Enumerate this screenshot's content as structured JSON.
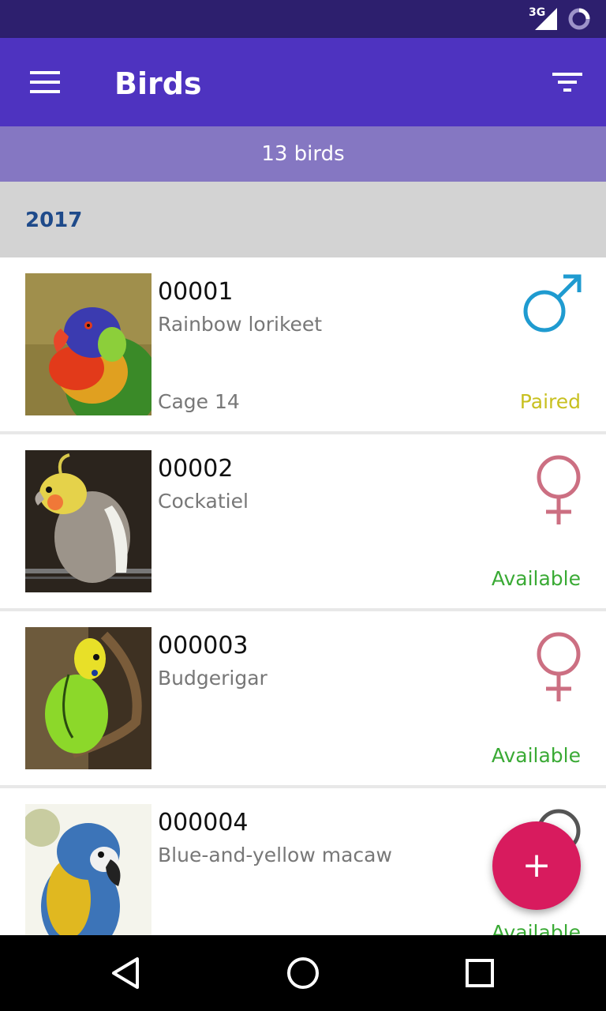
{
  "status_bar": {
    "network": "3G",
    "signal_icon": "signal-icon",
    "battery_icon": "battery-icon"
  },
  "app_bar": {
    "title": "Birds",
    "menu_icon": "menu-icon",
    "filter_icon": "filter-icon",
    "background": "#4e33c0"
  },
  "summary": {
    "count_label": "13 birds"
  },
  "section": {
    "year": "2017"
  },
  "birds": [
    {
      "id": "00001",
      "species": "Rainbow lorikeet",
      "cage": "Cage 14",
      "status": "Paired",
      "status_color": "#c8c020",
      "gender": "male",
      "gender_color": "#1f9bd0"
    },
    {
      "id": "00002",
      "species": "Cockatiel",
      "cage": "",
      "status": "Available",
      "status_color": "#3aaa35",
      "gender": "female",
      "gender_color": "#cc6f82"
    },
    {
      "id": "000003",
      "species": "Budgerigar",
      "cage": "",
      "status": "Available",
      "status_color": "#3aaa35",
      "gender": "female",
      "gender_color": "#cc6f82"
    },
    {
      "id": "000004",
      "species": "Blue-and-yellow macaw",
      "cage": "",
      "status": "Available",
      "status_color": "#3aaa35",
      "gender": "unknown",
      "gender_color": "#555555"
    }
  ],
  "fab": {
    "label": "+",
    "color": "#d81b5e"
  },
  "nav_bar": {
    "back_icon": "back-triangle-icon",
    "home_icon": "home-circle-icon",
    "recents_icon": "recents-square-icon"
  }
}
